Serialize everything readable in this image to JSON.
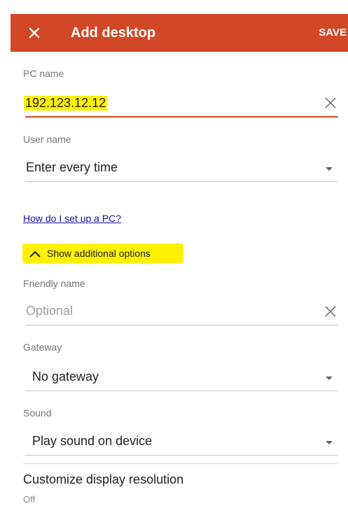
{
  "header": {
    "title": "Add desktop",
    "save_label": "SAVE",
    "accent_color": "#d24726"
  },
  "form": {
    "pc_name": {
      "label": "PC name",
      "value": "192.123.12.12"
    },
    "user_name": {
      "label": "User name",
      "value": "Enter every time"
    },
    "help_link": "How do I set up a PC?",
    "options_toggle": "Show additional options",
    "friendly_name": {
      "label": "Friendly name",
      "placeholder": "Optional"
    },
    "gateway": {
      "label": "Gateway",
      "value": "No gateway"
    },
    "sound": {
      "label": "Sound",
      "value": "Play sound on device"
    },
    "display": {
      "title": "Customize display resolution",
      "value": "Off"
    }
  },
  "icons": {
    "close": "close-icon",
    "clear": "clear-icon",
    "dropdown": "dropdown-arrow-icon",
    "chevron": "chevron-up-icon"
  }
}
